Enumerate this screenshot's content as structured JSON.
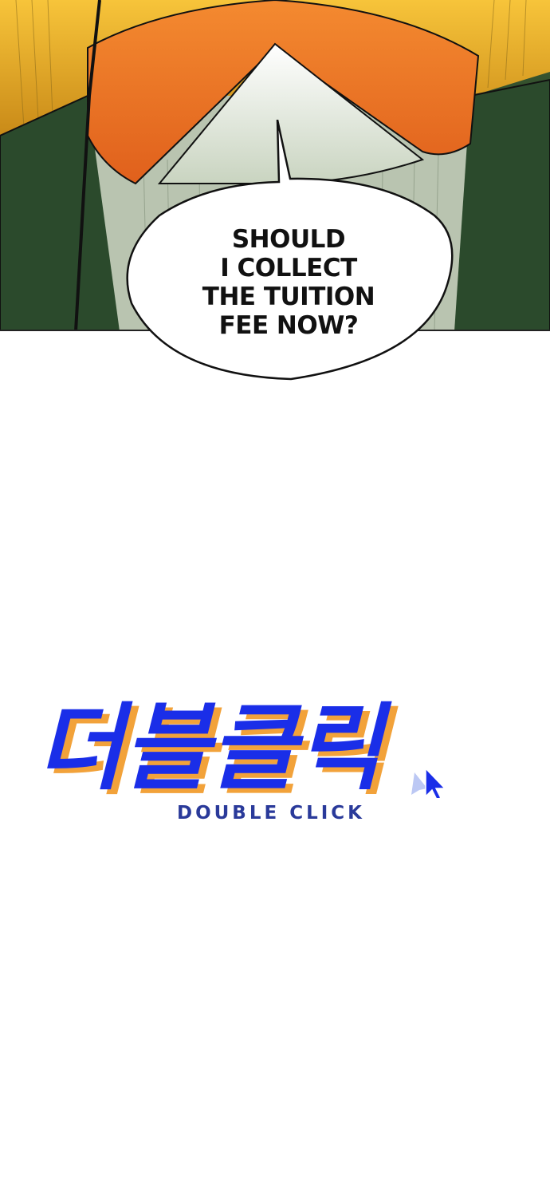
{
  "speech_bubble": {
    "lines": [
      "SHOULD",
      "I COLLECT",
      "THE TUITION",
      "FEE NOW?"
    ]
  },
  "logo": {
    "korean_title": "더블클릭",
    "english_title": "DOUBLE CLICK",
    "icon": "cursor-arrow-icon"
  },
  "colors": {
    "logo_blue": "#1a2ee8",
    "logo_sub_blue": "#2a3a9a",
    "logo_shadow_orange": "#f2a23a",
    "panel_orange": "#f07a28",
    "panel_yellow": "#f2b52c",
    "panel_green": "#2f4a2a"
  }
}
